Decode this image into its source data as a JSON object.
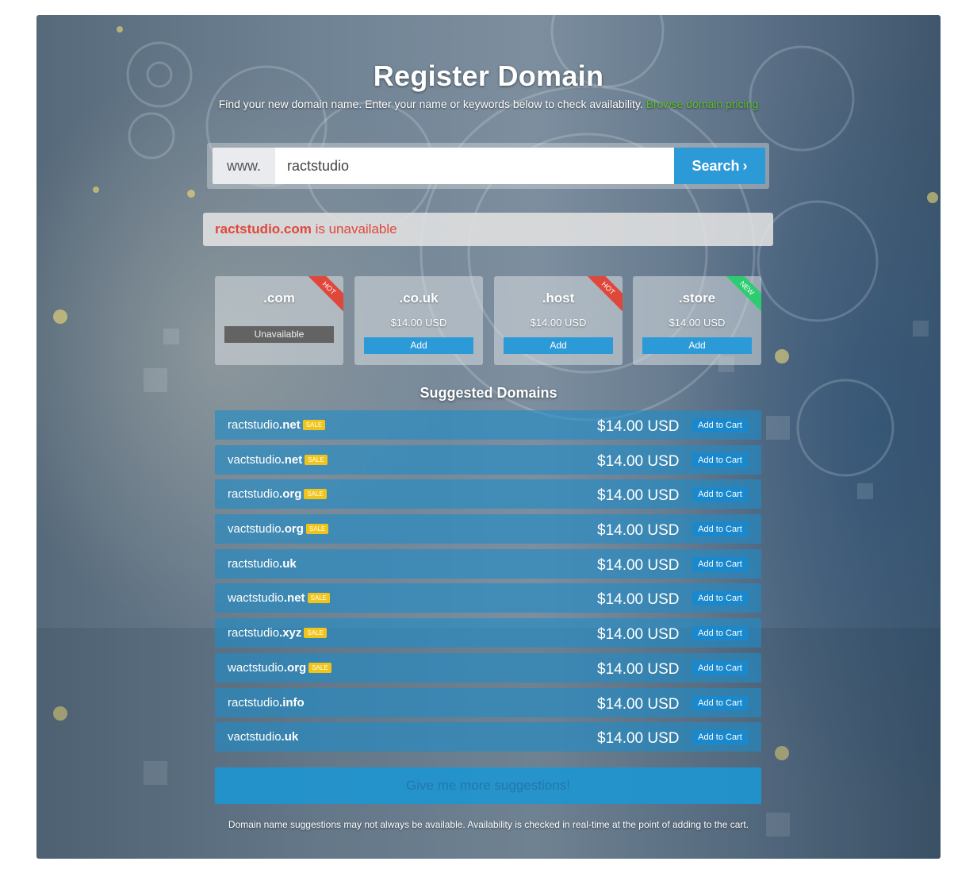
{
  "header": {
    "title": "Register Domain",
    "subtitle": "Find your new domain name. Enter your name or keywords below to check availability.",
    "pricing_link": "Browse domain pricing"
  },
  "search": {
    "prefix": "www.",
    "value": "ractstudio",
    "button_label": "Search"
  },
  "status": {
    "domain": "ractstudio.com",
    "message": " is unavailable"
  },
  "tlds": [
    {
      "name": ".com",
      "status": "Unavailable",
      "ribbon": "HOT"
    },
    {
      "name": ".co.uk",
      "price": "$14.00 USD",
      "add_label": "Add"
    },
    {
      "name": ".host",
      "price": "$14.00 USD",
      "add_label": "Add",
      "ribbon": "HOT"
    },
    {
      "name": ".store",
      "price": "$14.00 USD",
      "add_label": "Add",
      "ribbon": "NEW"
    }
  ],
  "suggestions": {
    "title": "Suggested Domains",
    "sale_label": "SALE",
    "cart_label": "Add to Cart",
    "items": [
      {
        "sld": "ractstudio",
        "tld": ".net",
        "sale": true,
        "price": "$14.00 USD"
      },
      {
        "sld": "vactstudio",
        "tld": ".net",
        "sale": true,
        "price": "$14.00 USD"
      },
      {
        "sld": "ractstudio",
        "tld": ".org",
        "sale": true,
        "price": "$14.00 USD"
      },
      {
        "sld": "vactstudio",
        "tld": ".org",
        "sale": true,
        "price": "$14.00 USD"
      },
      {
        "sld": "ractstudio",
        "tld": ".uk",
        "sale": false,
        "price": "$14.00 USD"
      },
      {
        "sld": "wactstudio",
        "tld": ".net",
        "sale": true,
        "price": "$14.00 USD"
      },
      {
        "sld": "ractstudio",
        "tld": ".xyz",
        "sale": true,
        "price": "$14.00 USD"
      },
      {
        "sld": "wactstudio",
        "tld": ".org",
        "sale": true,
        "price": "$14.00 USD"
      },
      {
        "sld": "ractstudio",
        "tld": ".info",
        "sale": false,
        "price": "$14.00 USD"
      },
      {
        "sld": "vactstudio",
        "tld": ".uk",
        "sale": false,
        "price": "$14.00 USD"
      }
    ],
    "more_label": "Give me more suggestions!"
  },
  "footer": {
    "disclaimer": "Domain name suggestions may not always be available. Availability is checked in real-time at the point of adding to the cart."
  },
  "colors": {
    "accent": "#2d9ad8",
    "danger": "#e0473b",
    "link": "#5ebd2e",
    "sale": "#f0c419",
    "new": "#2ecc71"
  }
}
